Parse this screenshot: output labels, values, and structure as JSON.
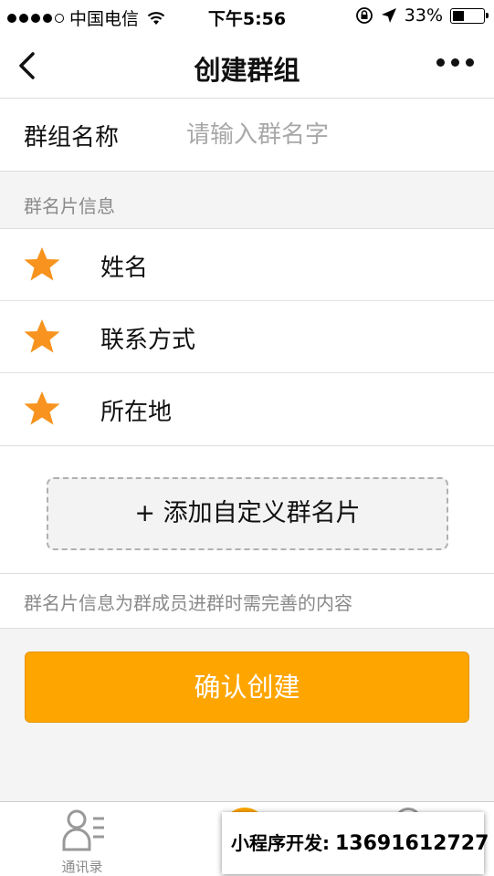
{
  "status_bar": {
    "carrier": "中国电信",
    "time": "下午5:56",
    "battery_percent": "33%",
    "battery_level": 0.33
  },
  "nav": {
    "title": "创建群组"
  },
  "group_name": {
    "label": "群组名称",
    "placeholder": "请输入群名字",
    "value": ""
  },
  "card_info": {
    "section_title": "群名片信息",
    "fields": [
      {
        "label": "姓名",
        "icon": "star-icon"
      },
      {
        "label": "联系方式",
        "icon": "star-icon"
      },
      {
        "label": "所在地",
        "icon": "star-icon"
      }
    ],
    "add_button_label": "+ 添加自定义群名片",
    "hint": "群名片信息为群成员进群时需完善的内容"
  },
  "confirm_label": "确认创建",
  "tab_bar": {
    "contacts_label": "通讯录"
  },
  "watermark": {
    "label": "小程序开发:",
    "phone": "13691612727"
  },
  "colors": {
    "accent": "#ffa500",
    "star": "#f7931e"
  }
}
